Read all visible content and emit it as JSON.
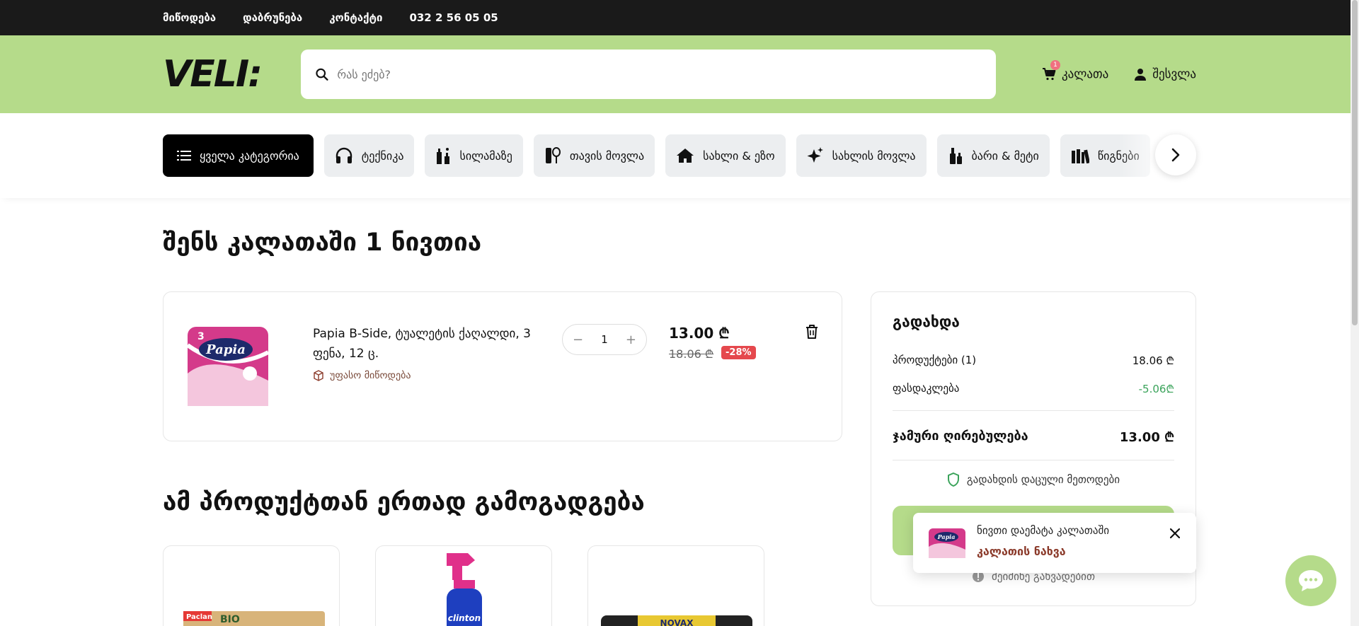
{
  "topbar": {
    "links": [
      "მიწოდება",
      "დაბრუნება",
      "კონტაქტი"
    ],
    "phone": "032 2 56 05 05"
  },
  "header": {
    "logo": "VELI:",
    "search_placeholder": "რას ეძებ?",
    "cart_label": "კალათა",
    "cart_count": "1",
    "login_label": "შესვლა"
  },
  "categories": [
    {
      "label": "ყველა კატეგორია",
      "icon": "list-icon"
    },
    {
      "label": "ტექნიკა",
      "icon": "headphones-icon"
    },
    {
      "label": "სილამაზე",
      "icon": "cosmetics-icon"
    },
    {
      "label": "თავის მოვლა",
      "icon": "care-icon"
    },
    {
      "label": "სახლი & ეზო",
      "icon": "home-icon"
    },
    {
      "label": "სახლის მოვლა",
      "icon": "sparkle-icon"
    },
    {
      "label": "ბარი & მეტი",
      "icon": "bottles-icon"
    },
    {
      "label": "წიგნები",
      "icon": "books-icon"
    }
  ],
  "cart": {
    "title": "შენს კალათაში 1 ნივთია",
    "item": {
      "name": "Papia B-Side, ტუალეტის ქაღალდი, 3 ფენა, 12 ც.",
      "shipping": "უფასო მიწოდება",
      "quantity": "1",
      "price": "13.00 ₾",
      "old_price": "18.06 ₾",
      "discount": "-28%"
    }
  },
  "recommendations": {
    "title": "ამ პროდუქტთან ერთად გამოგადგება"
  },
  "summary": {
    "title": "გადახდა",
    "products_label": "პროდუქტები (1)",
    "products_value": "18.06 ₾",
    "discount_label": "ფასდაკლება",
    "discount_value": "-5.06₾",
    "total_label": "ჯამური ღირებულება",
    "total_value": "13.00 ₾",
    "secure_label": "გადახდის დაცული მეთოდები",
    "later_label": "მეიძინე გახვადებით"
  },
  "toast": {
    "message": "ნივთი დაემატა კალათაში",
    "link": "კალათის ნახვა"
  },
  "colors": {
    "brand_green": "#b5db8a",
    "dark": "#1a1a1a",
    "discount_red": "#e5484d",
    "discount_green": "#3aa35a",
    "link_brown": "#8b3a2a"
  }
}
